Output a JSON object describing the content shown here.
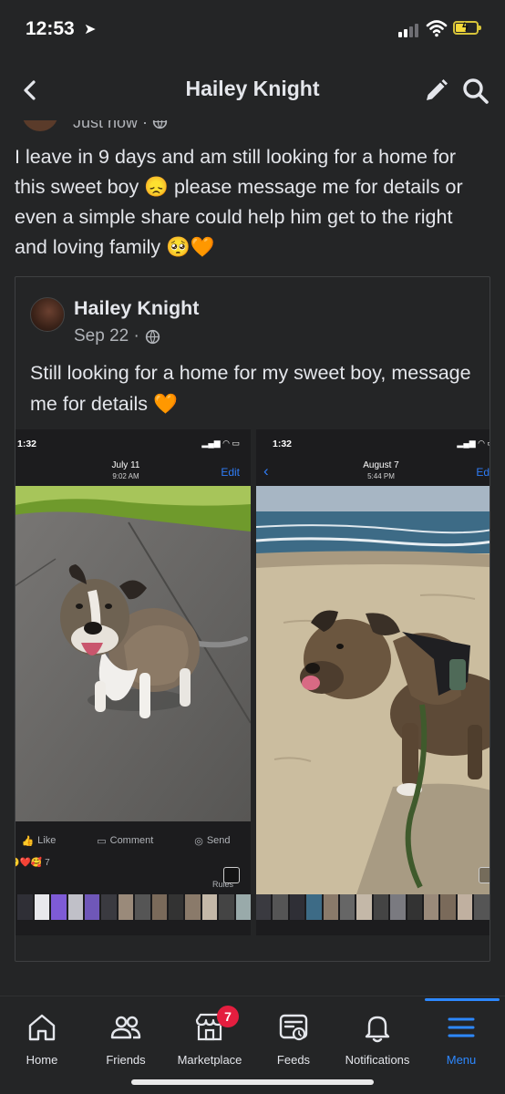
{
  "status_bar": {
    "time": "12:53",
    "battery_level": 0.5
  },
  "header": {
    "title": "Hailey Knight"
  },
  "post": {
    "meta": "Just now ·",
    "text": "I leave in 9 days and am still looking for a home for this sweet boy 😞 please message me for details or even a simple share could help him get to the right and loving family 🥺🧡"
  },
  "shared_post": {
    "author": "Hailey Knight",
    "date": "Sep 22 ·",
    "text": "Still looking for a home for my sweet boy, message me for details 🧡",
    "screenshots": [
      {
        "time": "1:32",
        "date": "July 11",
        "sub": "9:02 AM",
        "edit": "Edit",
        "actions": {
          "like": "Like",
          "comment": "Comment",
          "send": "Send"
        },
        "reactions": "😮❤️🥰 7",
        "rules": "Rules"
      },
      {
        "time": "1:32",
        "date": "August 7",
        "sub": "5:44 PM",
        "edit": "Edit"
      }
    ]
  },
  "bottom_nav": {
    "items": [
      {
        "label": "Home",
        "icon": "home-icon"
      },
      {
        "label": "Friends",
        "icon": "friends-icon"
      },
      {
        "label": "Marketplace",
        "icon": "marketplace-icon",
        "badge": "7"
      },
      {
        "label": "Feeds",
        "icon": "feeds-icon"
      },
      {
        "label": "Notifications",
        "icon": "bell-icon"
      },
      {
        "label": "Menu",
        "icon": "menu-icon",
        "active": true
      }
    ]
  },
  "colors": {
    "background": "#242526",
    "text": "#e4e6eb",
    "secondary_text": "#b0b3b8",
    "accent": "#2d88ff",
    "badge": "#e41e3f",
    "ios_link": "#2f7cf6"
  }
}
